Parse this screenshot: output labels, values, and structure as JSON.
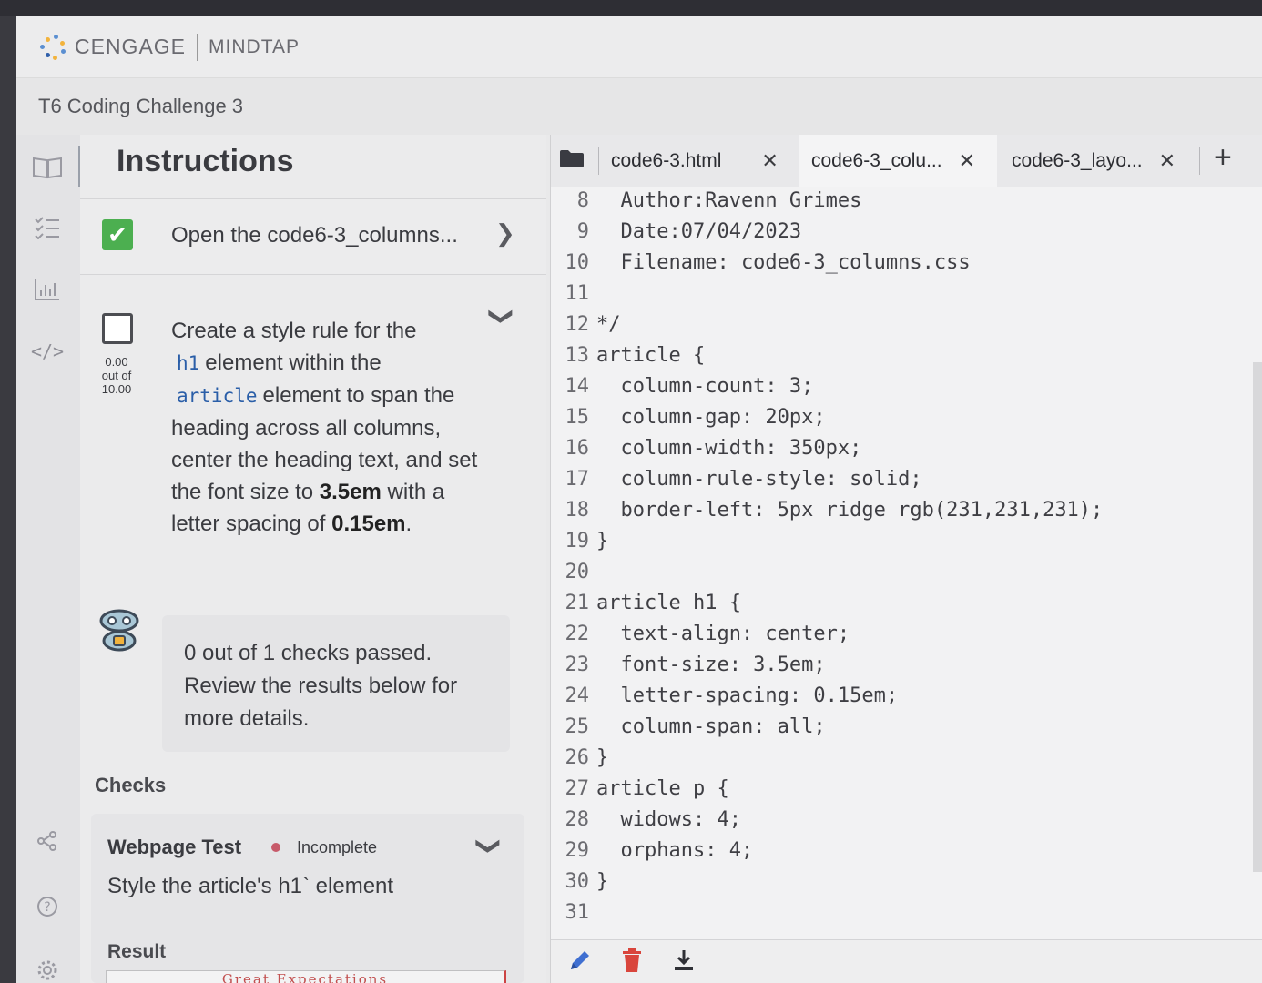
{
  "app": {
    "brand": "CENGAGE",
    "product": "MINDTAP",
    "page_title": "T6 Coding Challenge 3"
  },
  "instructions": {
    "heading": "Instructions",
    "step1": {
      "label": "Open the code6-3_columns...",
      "completed": true
    },
    "step2": {
      "text_parts": [
        "Create a style rule for the",
        "h1",
        "element within the",
        "article",
        "element to span the heading across all columns, center the heading text, and set the font size to",
        "3.5em",
        "with a letter spacing of",
        "0.15em",
        "."
      ],
      "score": "0.00",
      "score_out_of": "out of",
      "score_max": "10.00",
      "completed": false
    },
    "feedback": "0 out of 1 checks passed. Review the results below for more details.",
    "checks_label": "Checks",
    "check": {
      "title": "Webpage Test",
      "status": "Incomplete",
      "status_color": "#c75a6a",
      "description": "Style the article's h1` element",
      "result_label": "Result",
      "result_preview": "Great Expectations"
    }
  },
  "editor": {
    "tabs": [
      {
        "label": "code6-3.html",
        "active": false
      },
      {
        "label": "code6-3_colu...",
        "active": true
      },
      {
        "label": "code6-3_layo...",
        "active": false
      }
    ],
    "lines": [
      {
        "n": "8",
        "text": "  Author:Ravenn Grimes"
      },
      {
        "n": "9",
        "text": "  Date:07/04/2023"
      },
      {
        "n": "10",
        "text": "  Filename: code6-3_columns.css"
      },
      {
        "n": "11",
        "text": ""
      },
      {
        "n": "12",
        "text": "*/"
      },
      {
        "n": "13",
        "text": "article {"
      },
      {
        "n": "14",
        "text": "  column-count: 3;"
      },
      {
        "n": "15",
        "text": "  column-gap: 20px;"
      },
      {
        "n": "16",
        "text": "  column-width: 350px;"
      },
      {
        "n": "17",
        "text": "  column-rule-style: solid;"
      },
      {
        "n": "18",
        "text": "  border-left: 5px ridge rgb(231,231,231);"
      },
      {
        "n": "19",
        "text": "}"
      },
      {
        "n": "20",
        "text": ""
      },
      {
        "n": "21",
        "text": "article h1 {"
      },
      {
        "n": "22",
        "text": "  text-align: center;"
      },
      {
        "n": "23",
        "text": "  font-size: 3.5em;"
      },
      {
        "n": "24",
        "text": "  letter-spacing: 0.15em;"
      },
      {
        "n": "25",
        "text": "  column-span: all;"
      },
      {
        "n": "26",
        "text": "}"
      },
      {
        "n": "27",
        "text": "article p {"
      },
      {
        "n": "28",
        "text": "  widows: 4;"
      },
      {
        "n": "29",
        "text": "  orphans: 4;"
      },
      {
        "n": "30",
        "text": "}"
      },
      {
        "n": "31",
        "text": ""
      }
    ]
  },
  "icons": {
    "rail": [
      "book-icon",
      "checklist-icon",
      "chart-icon",
      "code-icon",
      "share-icon",
      "help-icon",
      "settings-icon"
    ],
    "toolbar": [
      "pencil-icon",
      "trash-icon",
      "download-icon"
    ]
  },
  "colors": {
    "checked": "#4caf50",
    "accent_code": "#2a5ea8",
    "trash": "#d9453c"
  }
}
